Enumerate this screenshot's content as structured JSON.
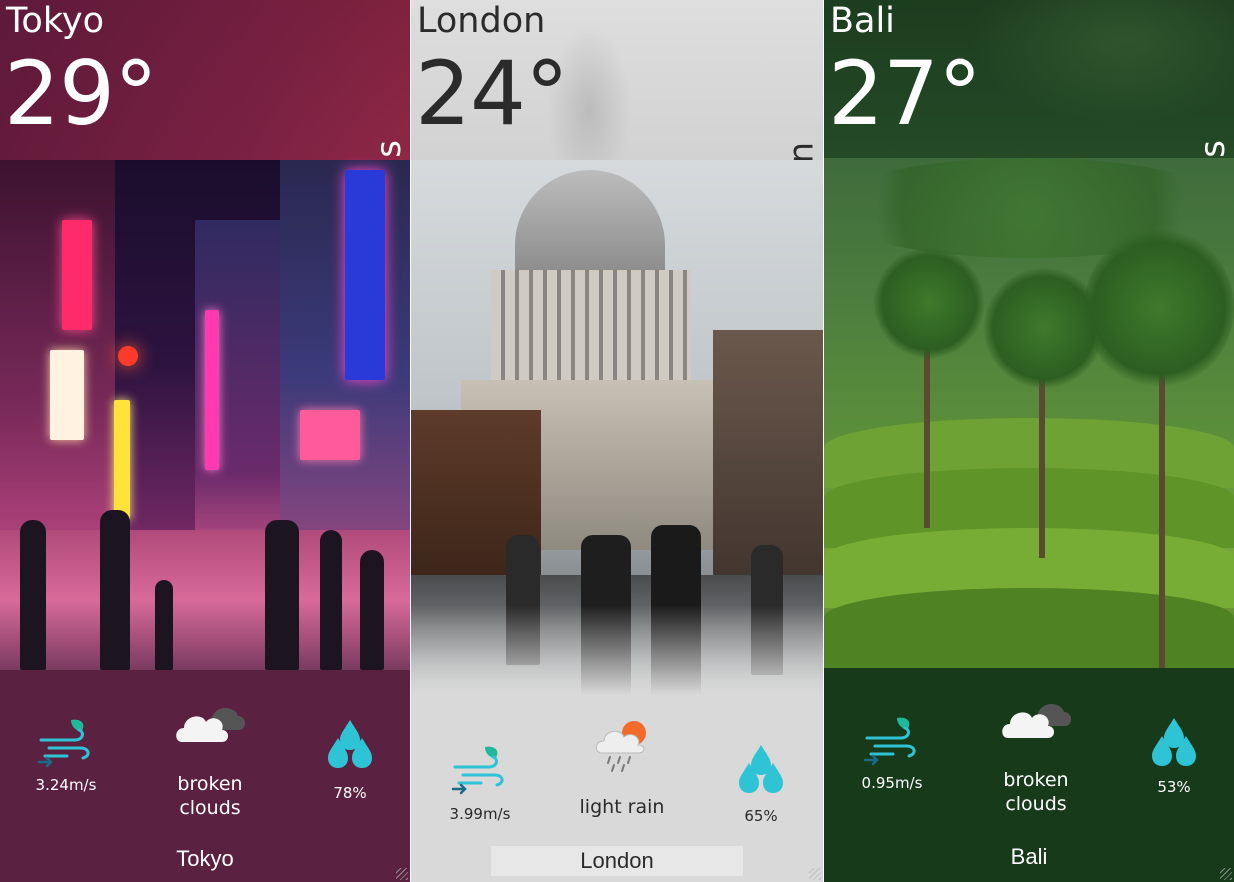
{
  "cards": [
    {
      "city": "Tokyo",
      "temperature": "29°",
      "weather_main": "Clouds",
      "wind": "3.24m/s",
      "condition": [
        "broken",
        "clouds"
      ],
      "humidity": "78%",
      "footer_city": "Tokyo",
      "icons": {
        "wind": "wind-icon",
        "condition": "broken-clouds-icon",
        "humidity": "humidity-drops-icon"
      }
    },
    {
      "city": "London",
      "temperature": "24°",
      "weather_main": "Rain",
      "wind": "3.99m/s",
      "condition": [
        "light rain"
      ],
      "humidity": "65%",
      "footer_city": "London",
      "icons": {
        "wind": "wind-icon",
        "condition": "light-rain-icon",
        "humidity": "humidity-drops-icon"
      }
    },
    {
      "city": "Bali",
      "temperature": "27°",
      "weather_main": "Clouds",
      "wind": "0.95m/s",
      "condition": [
        "broken",
        "clouds"
      ],
      "humidity": "53%",
      "footer_city": "Bali",
      "icons": {
        "wind": "wind-icon",
        "condition": "broken-clouds-icon",
        "humidity": "humidity-drops-icon"
      }
    }
  ],
  "colors": {
    "tokyo_bg": "#5a2140",
    "london_bg": "#d9d9d9",
    "bali_bg": "#173a1b",
    "icon_teal": "#2ec4d6",
    "icon_leaf": "#1fb89a",
    "sun_orange": "#f26b2b"
  }
}
